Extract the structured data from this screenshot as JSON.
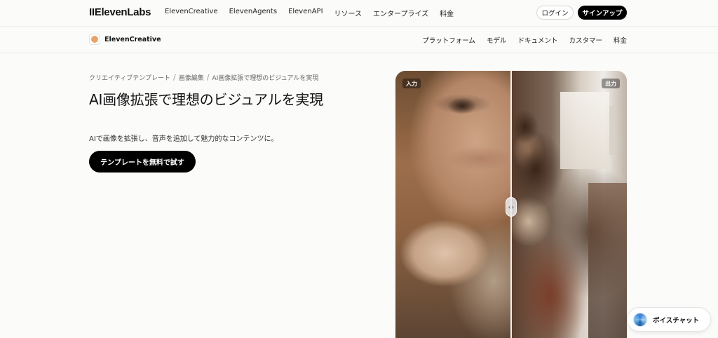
{
  "topnav": {
    "logo": "IIElevenLabs",
    "links": [
      "ElevenCreative",
      "ElevenAgents",
      "ElevenAPI",
      "リソース",
      "エンタープライズ",
      "料金"
    ],
    "login_label": "ログイン",
    "signup_label": "サインアップ"
  },
  "subnav": {
    "brand": "ElevenCreative",
    "brand_color": "#e5a46a",
    "links": [
      "プラットフォーム",
      "モデル",
      "ドキュメント",
      "カスタマー",
      "料金"
    ]
  },
  "breadcrumb": {
    "items": [
      "クリエイティブテンプレート",
      "画像編集",
      "AI画像拡張で理想のビジュアルを実現"
    ],
    "separator": "/"
  },
  "hero": {
    "title": "AI画像拡張で理想のビジュアルを実現",
    "subtitle": "AIで画像を拡張し、音声を追加して魅力的なコンテンツに。",
    "cta_label": "テンプレートを無料で試す"
  },
  "compare": {
    "input_label": "入力",
    "output_label": "出力",
    "handle_glyph": "‹›",
    "handle_icon": "chevron-left-right-icon",
    "split": 0.5
  },
  "voice_widget": {
    "label": "ボイスチャット",
    "icon": "voice-orb-icon"
  }
}
